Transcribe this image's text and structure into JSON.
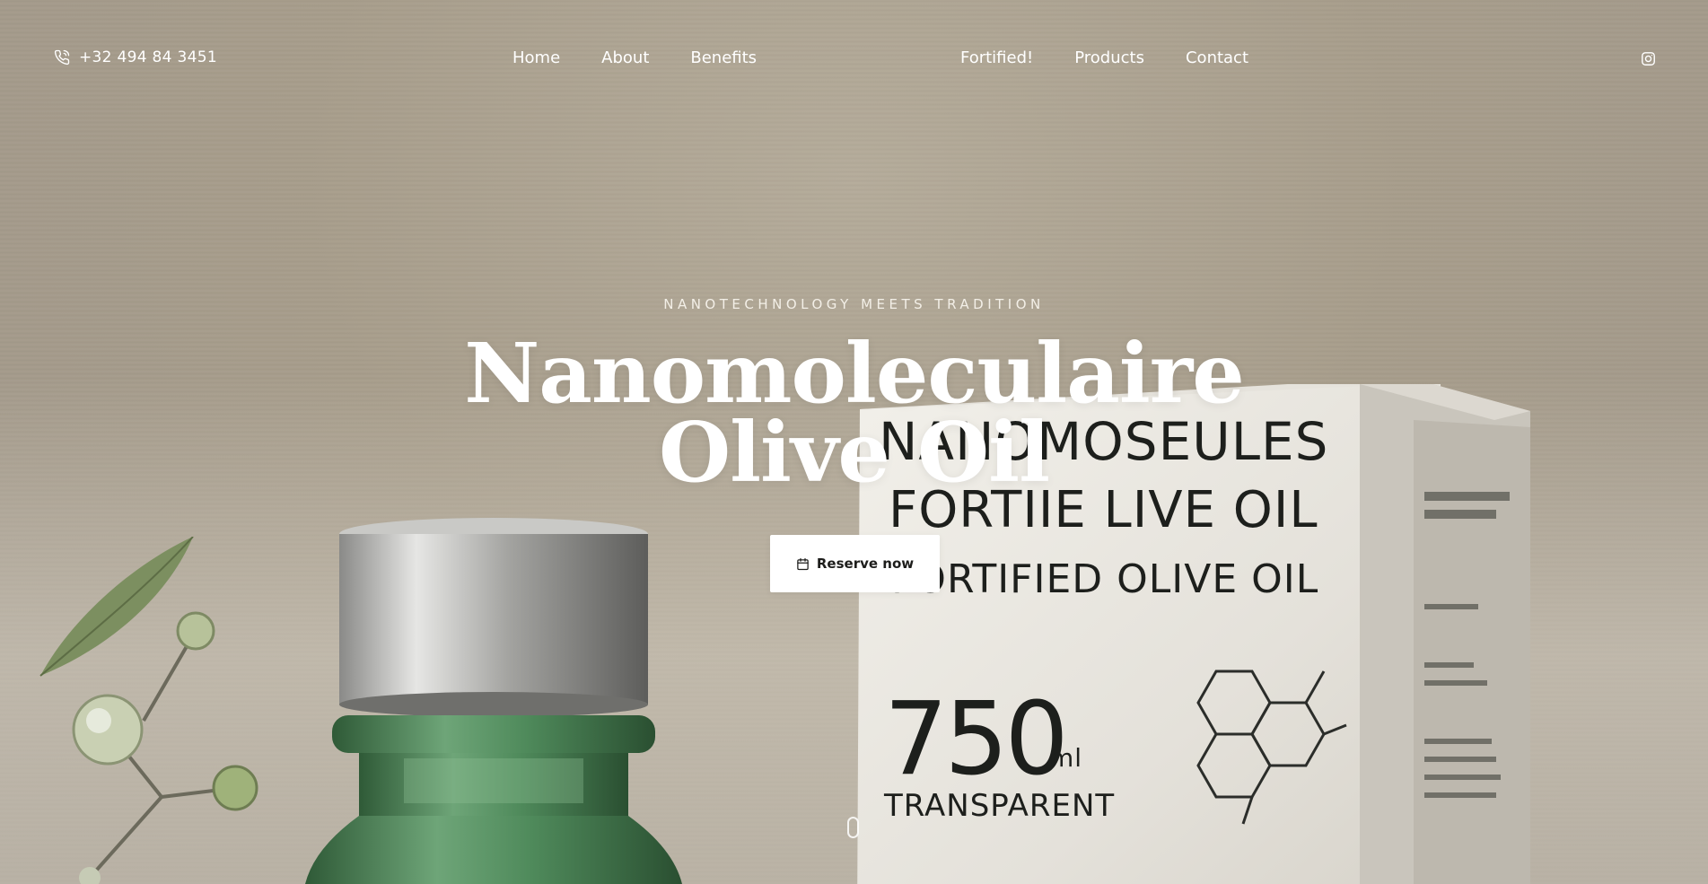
{
  "header": {
    "phone": "+32 494 84 3451",
    "nav_left": [
      {
        "label": "Home"
      },
      {
        "label": "About"
      },
      {
        "label": "Benefits"
      }
    ],
    "nav_right": [
      {
        "label": "Fortified!"
      },
      {
        "label": "Products"
      },
      {
        "label": "Contact"
      }
    ],
    "social_icon": "instagram-icon"
  },
  "hero": {
    "eyebrow": "NANOTECHNOLOGY MEETS TRADITION",
    "title_line1": "Nanomoleculaire",
    "title_line2": "Olive Oil",
    "cta_label": "Reserve now",
    "cta_icon": "calendar-icon"
  },
  "product_image": {
    "box_line1": "NANOMOSEULES",
    "box_line2": "FORTIIE LIVE OIL",
    "box_line3": "FORTIFIED OLIVE OIL",
    "box_volume": "750",
    "box_unit": "ml",
    "box_line4": "TRANSPARENT"
  },
  "colors": {
    "background": "#a79d8b",
    "text": "#ffffff",
    "cta_background": "#ffffff",
    "cta_text": "#1d1d1b",
    "bottle_green": "#4f8a5b"
  }
}
